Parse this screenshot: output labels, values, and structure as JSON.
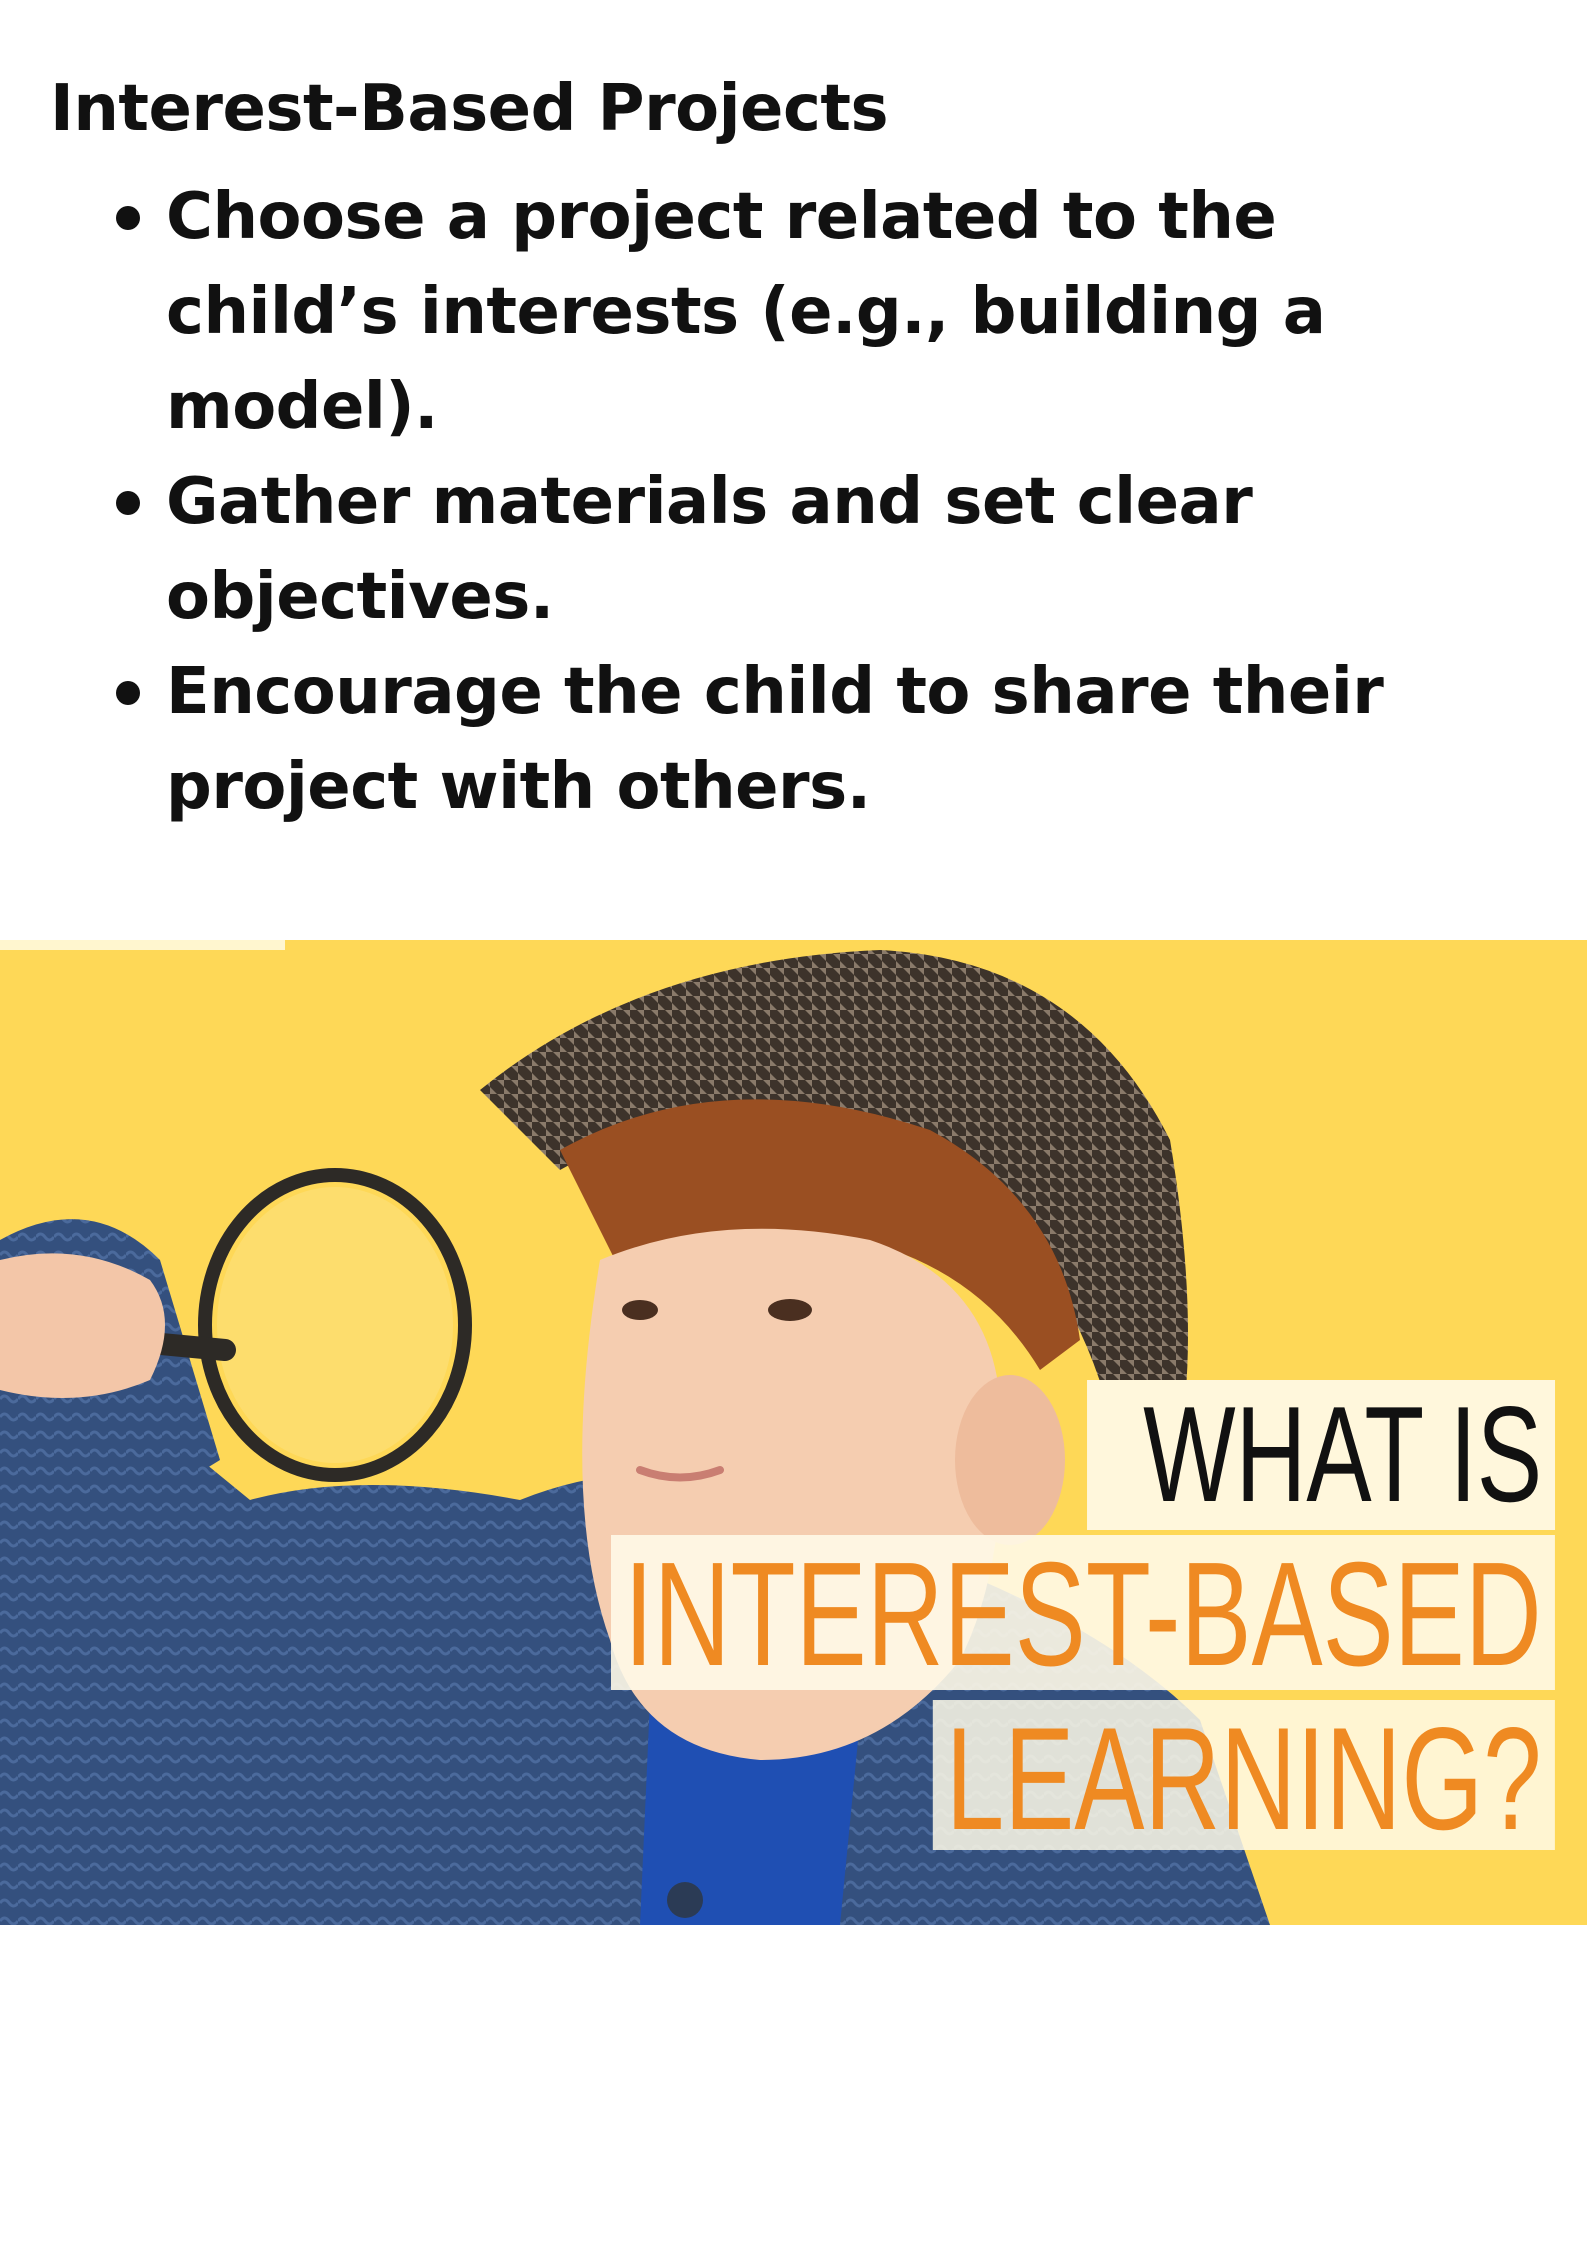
{
  "page": {
    "title": "Interest-Based Projects",
    "bullets": [
      "Choose a project related to the child’s interests (e.g., building a model).",
      "Gather materials and set clear objectives.",
      "Encourage the child to share their project with others."
    ]
  },
  "hero_image": {
    "caption_line_1": "WHAT IS",
    "caption_line_2": "INTEREST-BASED",
    "caption_line_3": "LEARNING?",
    "colors": {
      "background": "#fed857",
      "caption_dark": "#111111",
      "caption_accent": "#ef8a22"
    }
  }
}
